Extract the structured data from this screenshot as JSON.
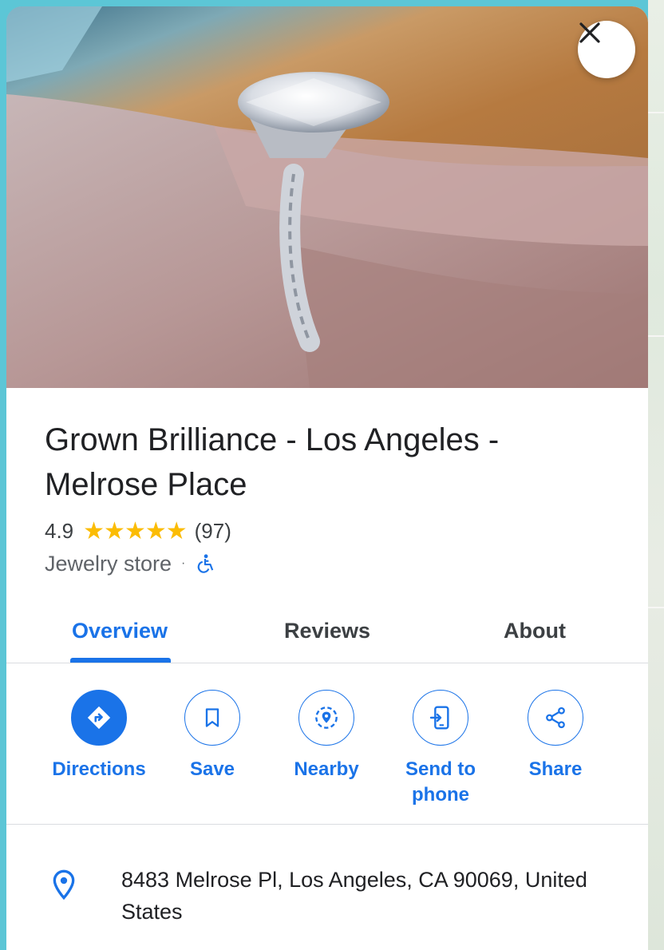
{
  "place": {
    "name": "Grown Brilliance - Los Angeles - Melrose Place",
    "rating": "4.9",
    "stars": "★★★★★",
    "review_count": "(97)",
    "category": "Jewelry store",
    "separator": "·",
    "address": "8483 Melrose Pl, Los Angeles, CA 90069, United States"
  },
  "tabs": [
    {
      "label": "Overview",
      "active": true
    },
    {
      "label": "Reviews",
      "active": false
    },
    {
      "label": "About",
      "active": false
    }
  ],
  "actions": [
    {
      "label": "Directions",
      "icon": "directions-icon"
    },
    {
      "label": "Save",
      "icon": "bookmark-icon"
    },
    {
      "label": "Nearby",
      "icon": "nearby-icon"
    },
    {
      "label": "Send to phone",
      "icon": "send-to-phone-icon"
    },
    {
      "label": "Share",
      "icon": "share-icon"
    }
  ],
  "colors": {
    "accent": "#1a73e8",
    "star": "#fbbc04",
    "text": "#202124"
  }
}
